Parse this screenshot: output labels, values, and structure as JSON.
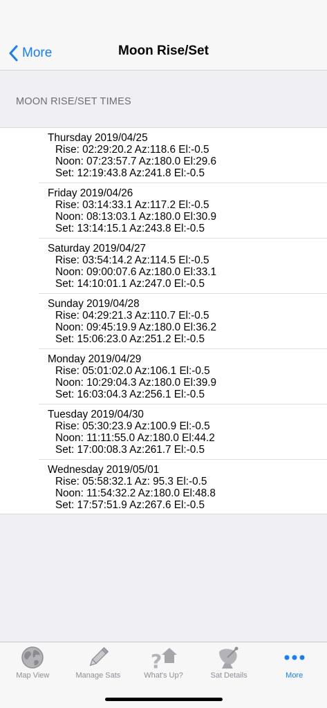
{
  "nav": {
    "back_label": "More",
    "title": "Moon Rise/Set"
  },
  "section_header": "MOON RISE/SET TIMES",
  "days": [
    {
      "date": "Thursday 2019/04/25",
      "rise": "Rise: 02:29:20.2 Az:118.6 El:-0.5",
      "noon": "Noon: 07:23:57.7 Az:180.0 El:29.6",
      "set": "Set: 12:19:43.8 Az:241.8 El:-0.5"
    },
    {
      "date": "Friday 2019/04/26",
      "rise": "Rise: 03:14:33.1 Az:117.2 El:-0.5",
      "noon": "Noon: 08:13:03.1 Az:180.0 El:30.9",
      "set": "Set: 13:14:15.1 Az:243.8 El:-0.5"
    },
    {
      "date": "Saturday 2019/04/27",
      "rise": "Rise: 03:54:14.2 Az:114.5 El:-0.5",
      "noon": "Noon: 09:00:07.6 Az:180.0 El:33.1",
      "set": "Set: 14:10:01.1 Az:247.0 El:-0.5"
    },
    {
      "date": "Sunday 2019/04/28",
      "rise": "Rise: 04:29:21.3 Az:110.7 El:-0.5",
      "noon": "Noon: 09:45:19.9 Az:180.0 El:36.2",
      "set": "Set: 15:06:23.0 Az:251.2 El:-0.5"
    },
    {
      "date": "Monday 2019/04/29",
      "rise": "Rise: 05:01:02.0 Az:106.1 El:-0.5",
      "noon": "Noon: 10:29:04.3 Az:180.0 El:39.9",
      "set": "Set: 16:03:04.3 Az:256.1 El:-0.5"
    },
    {
      "date": "Tuesday 2019/04/30",
      "rise": "Rise: 05:30:23.9 Az:100.9 El:-0.5",
      "noon": "Noon: 11:11:55.0 Az:180.0 El:44.2",
      "set": "Set: 17:00:08.3 Az:261.7 El:-0.5"
    },
    {
      "date": "Wednesday 2019/05/01",
      "rise": "Rise: 05:58:32.1 Az: 95.3 El:-0.5",
      "noon": "Noon: 11:54:32.2 Az:180.0 El:48.8",
      "set": "Set: 17:57:51.9 Az:267.6 El:-0.5"
    }
  ],
  "tabs": [
    {
      "label": "Map View",
      "icon": "globe-icon"
    },
    {
      "label": "Manage Sats",
      "icon": "pencil-icon"
    },
    {
      "label": "What's Up?",
      "icon": "question-house-icon"
    },
    {
      "label": "Sat Details",
      "icon": "satellite-dish-icon"
    },
    {
      "label": "More",
      "icon": "more-dots-icon",
      "active": true
    }
  ],
  "colors": {
    "accent": "#157efb",
    "inactive_tab": "#8e8e93",
    "background": "#efeff4"
  }
}
